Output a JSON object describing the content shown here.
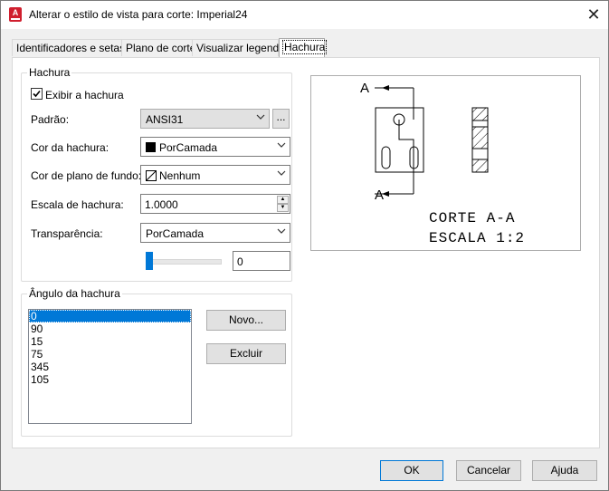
{
  "window": {
    "title": "Alterar o estilo de vista para corte: Imperial24",
    "app_icon": "autocad-icon",
    "close_icon": "close-icon"
  },
  "tabs": [
    {
      "label": "Identificadores e setas"
    },
    {
      "label": "Plano de corte"
    },
    {
      "label": "Visualizar legenda"
    },
    {
      "label": "Hachura",
      "active": true
    }
  ],
  "hatch_group": {
    "title": "Hachura",
    "show_hatch": {
      "label": "Exibir a hachura",
      "checked": true
    },
    "pattern": {
      "label": "Padrão:",
      "value": "ANSI31",
      "browse_label": "..."
    },
    "hatch_color": {
      "label": "Cor da hachura:",
      "value": "PorCamada",
      "swatch": "#000000"
    },
    "background_color": {
      "label": "Cor de plano de fundo:",
      "value": "Nenhum"
    },
    "hatch_scale": {
      "label": "Escala de hachura:",
      "value": "1.0000"
    },
    "transparency": {
      "label": "Transparência:",
      "value": "PorCamada",
      "slider_value": "0",
      "slider_fraction": 0
    }
  },
  "angle_group": {
    "title": "Ângulo da hachura",
    "angles": [
      "0",
      "90",
      "15",
      "75",
      "345",
      "105"
    ],
    "selected_index": 0,
    "new_button": "Novo...",
    "delete_button": "Excluir"
  },
  "preview": {
    "section_label_top": "A",
    "section_label_bottom": "A",
    "caption_line1": "CORTE A-A",
    "caption_line2": "ESCALA 1:2"
  },
  "footer": {
    "ok": "OK",
    "cancel": "Cancelar",
    "help": "Ajuda"
  },
  "colors": {
    "accent": "#0078d7",
    "brand": "#d01f2e"
  }
}
